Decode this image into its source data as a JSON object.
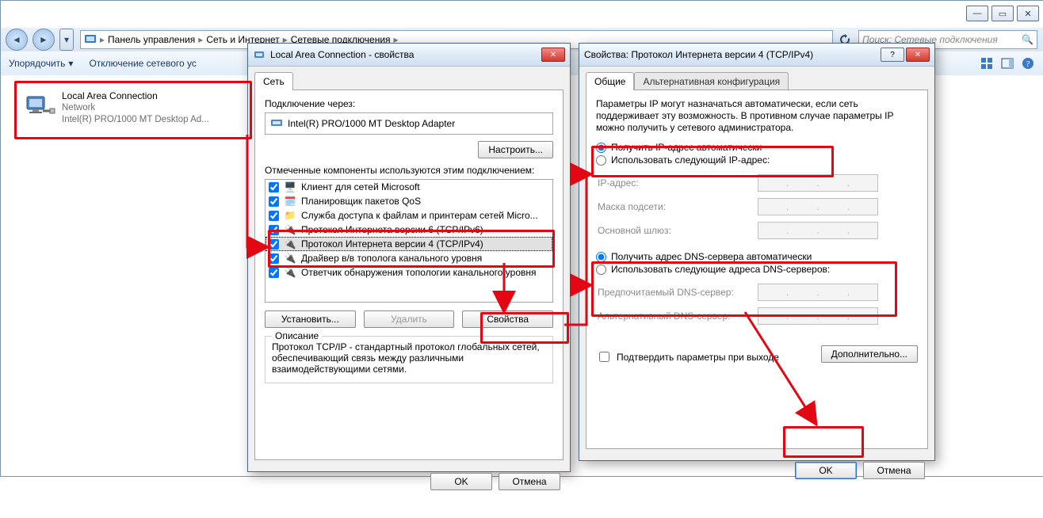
{
  "explorer": {
    "breadcrumb": [
      "Панель управления",
      "Сеть и Интернет",
      "Сетевые подключения"
    ],
    "search_placeholder": "Поиск: Сетевые подключения",
    "toolbar": {
      "organize": "Упорядочить",
      "disable": "Отключение сетевого ус"
    },
    "connection": {
      "name": "Local Area Connection",
      "net": "Network",
      "adapter": "Intel(R) PRO/1000 MT Desktop Ad..."
    }
  },
  "dlg1": {
    "title": "Local Area Connection - свойства",
    "tab_net": "Сеть",
    "conn_via": "Подключение через:",
    "adapter": "Intel(R) PRO/1000 MT Desktop Adapter",
    "configure": "Настроить...",
    "components_label": "Отмеченные компоненты используются этим подключением:",
    "components": [
      "Клиент для сетей Microsoft",
      "Планировщик пакетов QoS",
      "Служба доступа к файлам и принтерам сетей Micro...",
      "Протокол Интернета версии 6 (TCP/IPv6)",
      "Протокол Интернета версии 4 (TCP/IPv4)",
      "Драйвер в/в тополога канального уровня",
      "Ответчик обнаружения топологии канального уровня"
    ],
    "install": "Установить...",
    "remove": "Удалить",
    "properties": "Свойства",
    "desc_legend": "Описание",
    "desc_text": "Протокол TCP/IP - стандартный протокол глобальных сетей, обеспечивающий связь между различными взаимодействующими сетями.",
    "ok": "OK",
    "cancel": "Отмена"
  },
  "dlg2": {
    "title": "Свойства: Протокол Интернета версии 4 (TCP/IPv4)",
    "tab_general": "Общие",
    "tab_alt": "Альтернативная конфигурация",
    "para": "Параметры IP могут назначаться автоматически, если сеть поддерживает эту возможность. В противном случае параметры IP можно получить у сетевого администратора.",
    "r_auto_ip": "Получить IP-адрес автоматически",
    "r_manual_ip": "Использовать следующий IP-адрес:",
    "k_ip": "IP-адрес:",
    "k_mask": "Маска подсети:",
    "k_gw": "Основной шлюз:",
    "r_auto_dns": "Получить адрес DNS-сервера автоматически",
    "r_manual_dns": "Использовать следующие адреса DNS-серверов:",
    "k_dns1": "Предпочитаемый DNS-сервер:",
    "k_dns2": "Альтернативный DNS-сервер:",
    "chk_validate": "Подтвердить параметры при выходе",
    "advanced": "Дополнительно...",
    "ok": "OK",
    "cancel": "Отмена"
  }
}
